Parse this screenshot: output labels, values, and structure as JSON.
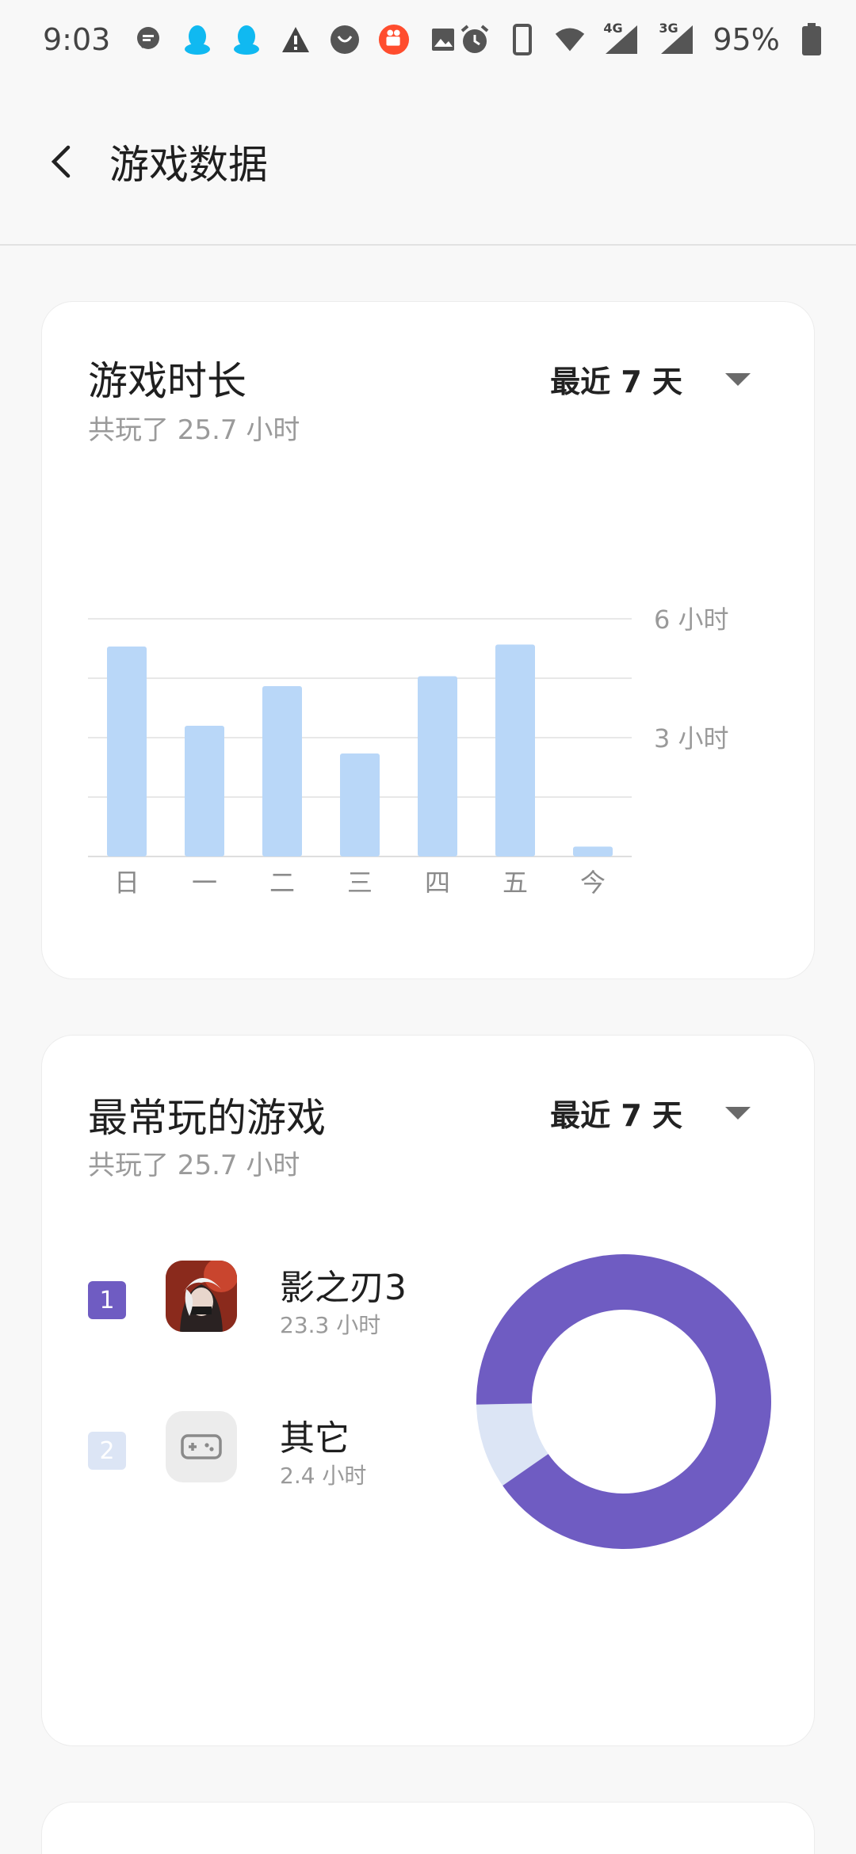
{
  "status_bar": {
    "time": "9:03",
    "left_icons": [
      "message-icon",
      "qq-icon",
      "qq-icon",
      "warning-icon",
      "taobao-icon",
      "kuaishou-icon",
      "gallery-icon"
    ],
    "right_icons": [
      "alarm-icon",
      "phone-icon",
      "wifi-icon",
      "signal-4g-icon",
      "signal-3g-icon",
      "battery-icon"
    ],
    "network_1": "4G",
    "network_2": "3G",
    "battery": "95%"
  },
  "app_bar": {
    "title": "游戏数据"
  },
  "duration_card": {
    "title": "游戏时长",
    "subtitle": "共玩了 25.7 小时",
    "range_label": "最近 7 天"
  },
  "ranking_card": {
    "title": "最常玩的游戏",
    "subtitle": "共玩了 25.7 小时",
    "range_label": "最近 7 天",
    "items": [
      {
        "rank": "1",
        "name": "影之刃3",
        "time": "23.3 小时",
        "color": "#6f5cc2",
        "icon": "game-avatar-icon"
      },
      {
        "rank": "2",
        "name": "其它",
        "time": "2.4 小时",
        "color": "#dce5f5",
        "icon": "gamepad-icon"
      }
    ]
  },
  "colors": {
    "bar": "#b9d7f8",
    "primary": "#6f5cc2",
    "secondary": "#dce5f5"
  },
  "chart_data": [
    {
      "type": "bar",
      "categories": [
        "日",
        "一",
        "二",
        "三",
        "四",
        "五",
        "今"
      ],
      "values": [
        5.3,
        3.3,
        4.3,
        2.6,
        4.55,
        5.35,
        0.25
      ],
      "ytick_labels": [
        "6 小时",
        "3 小时"
      ],
      "yticks": [
        6,
        3
      ],
      "ylim": [
        0,
        6
      ],
      "grid": true
    },
    {
      "type": "pie",
      "donut": true,
      "labels": [
        "影之刃3",
        "其它"
      ],
      "values": [
        23.3,
        2.4
      ]
    }
  ]
}
